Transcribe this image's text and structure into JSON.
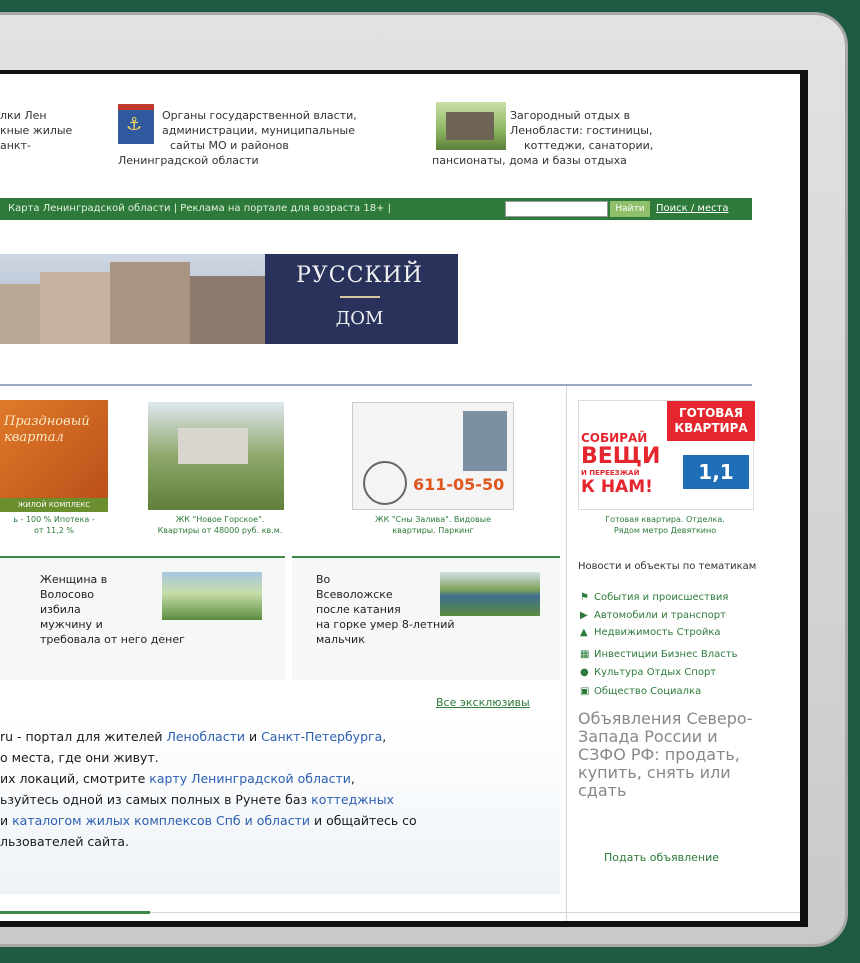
{
  "header": {
    "col_a": [
      "лки Лен",
      "кные жилые",
      "анкт-"
    ],
    "col_b": [
      "Органы государственной власти,",
      "администрации, муниципальные",
      "сайты МО и районов",
      "Ленинградской области"
    ],
    "col_c": [
      "Загородный отдых в",
      "Ленобласти: гостиницы,",
      "коттеджи, санатории,",
      "пансионаты, дома и базы отдыха"
    ]
  },
  "navbar": {
    "links": "Карта Ленинградской области | Реклама на портале   для возраста 18+   |",
    "find_button": "Найти",
    "search_link": "Поиск / места"
  },
  "banner": {
    "title": "РУССКИЙ",
    "subtitle": "ДОМ"
  },
  "cards": [
    {
      "overlay": "Празднoвый квартал",
      "caption_lines": [
        "ь - 100 % Ипотека -",
        "от 11,2 %"
      ],
      "subtag": "ЖИЛОЙ КОМПЛЕКС"
    },
    {
      "caption_lines": [
        "ЖК \"Новое Горское\".",
        "Квартиры от 48000 руб. кв.м."
      ]
    },
    {
      "phone": "611-05-50",
      "caption_lines": [
        "ЖК \"Сны Залива\". Видовые",
        "квартиры. Паркинг"
      ]
    }
  ],
  "ad": {
    "lines": [
      "ГОТОВАЯ",
      "КВАРТИРА",
      "СОБИРАЙ",
      "ВЕЩИ",
      "И ПЕРЕЕЗЖАЙ",
      "К НАМ!",
      "1,1"
    ],
    "caption_lines": [
      "Готовая квартира. Отделка.",
      "Рядом метро Девяткино"
    ]
  },
  "news": {
    "heading": "Новости и объекты по тематикам",
    "items": [
      {
        "icon": "⚑",
        "label": "События и происшествия"
      },
      {
        "icon": "▶",
        "label": "Автомобили и транспорт"
      },
      {
        "icon": "▲",
        "label": "Недвижимость Стройка"
      },
      {
        "icon": "▦",
        "label": "Инвестиции Бизнес Власть"
      },
      {
        "icon": "●",
        "label": "Культура Отдых Спорт"
      },
      {
        "icon": "▣",
        "label": "Общество Социалка"
      }
    ]
  },
  "ads_block": {
    "text": "Объявления Северо-Запада России и СЗФО РФ: продать, купить, снять или сдать",
    "post_link": "Подать объявление"
  },
  "exclusives": [
    {
      "lines": [
        "Женщина в",
        "Волосово",
        "избила",
        "мужчину и",
        "требовала от него денег"
      ]
    },
    {
      "lines": [
        "Во",
        "Всеволожске",
        "после катания",
        "на горке умер 8-летний",
        "мальчик"
      ]
    }
  ],
  "all_exclusives": "Все эксклюзивы",
  "intro": {
    "l1_a": "ru - портал для жителей ",
    "l1_link1": "Ленобласти",
    "l1_b": " и ",
    "l1_link2": "Санкт-Петербурга",
    "l1_c": ",",
    "l2": "о места, где они живут.",
    "l3_a": "их локаций, смотрите ",
    "l3_link": "карту Ленинградской области",
    "l3_b": ",",
    "l4_a": "ьзуйтесь одной из самых полных в Рунете баз ",
    "l4_link": "коттеджных",
    "l5_a": " и ",
    "l5_link": "каталогом жилых комплексов Спб и области",
    "l5_b": " и общайтесь со",
    "l6": "льзователей сайта."
  }
}
